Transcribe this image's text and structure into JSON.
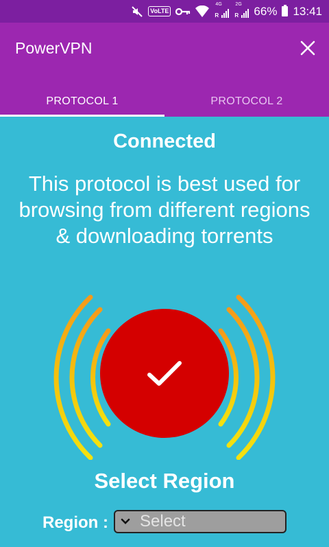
{
  "status_bar": {
    "volte_label": "VoLTE",
    "sim1_network": "4G",
    "sim2_network": "2G",
    "roaming": "R",
    "battery": "66%",
    "time": "13:41"
  },
  "app": {
    "title": "PowerVPN"
  },
  "tabs": [
    {
      "label": "PROTOCOL 1",
      "selected": true
    },
    {
      "label": "PROTOCOL 2",
      "selected": false
    }
  ],
  "connection": {
    "status": "Connected",
    "description": "This protocol is best used for browsing from different regions & downloading torrents"
  },
  "region": {
    "title": "Select Region",
    "label": "Region :",
    "selected_value": "Select"
  },
  "colors": {
    "status_bar": "#7C1FA0",
    "app_bar": "#9C27B0",
    "background": "#36BBD5",
    "connect_button": "#D40000",
    "wave_inner": "#F4E10F",
    "wave_outer": "#F59A1A"
  },
  "icons": {
    "status": [
      "mute-icon",
      "key-icon",
      "wifi-icon",
      "signal-icon",
      "battery-icon"
    ],
    "close": "close-icon",
    "connect": "checkmark-icon",
    "select": "chevron-down-icon"
  }
}
